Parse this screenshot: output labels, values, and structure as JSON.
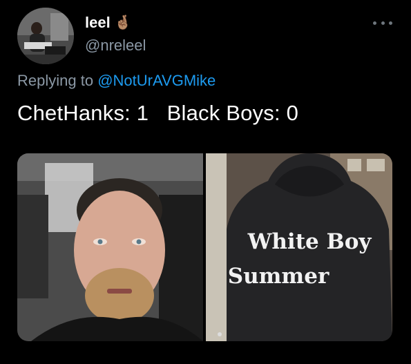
{
  "tweet": {
    "display_name": "leel",
    "name_emoji": "🤞🏽",
    "handle": "@nreleel",
    "replying_prefix": "Replying to",
    "replying_to": "@NotUrAVGMike",
    "text": "ChetHanks: 1   Black Boys: 0"
  },
  "media": [
    {
      "description": "man-selfie-in-car"
    },
    {
      "hoodie_text_line1": "White Boy",
      "hoodie_text_line2": "Summer"
    }
  ],
  "colors": {
    "background": "#000000",
    "primary_text": "#ffffff",
    "secondary_text": "#8b98a5",
    "link": "#1d9bf0"
  },
  "icons": [
    "more-icon",
    "crossed-fingers-emoji"
  ]
}
